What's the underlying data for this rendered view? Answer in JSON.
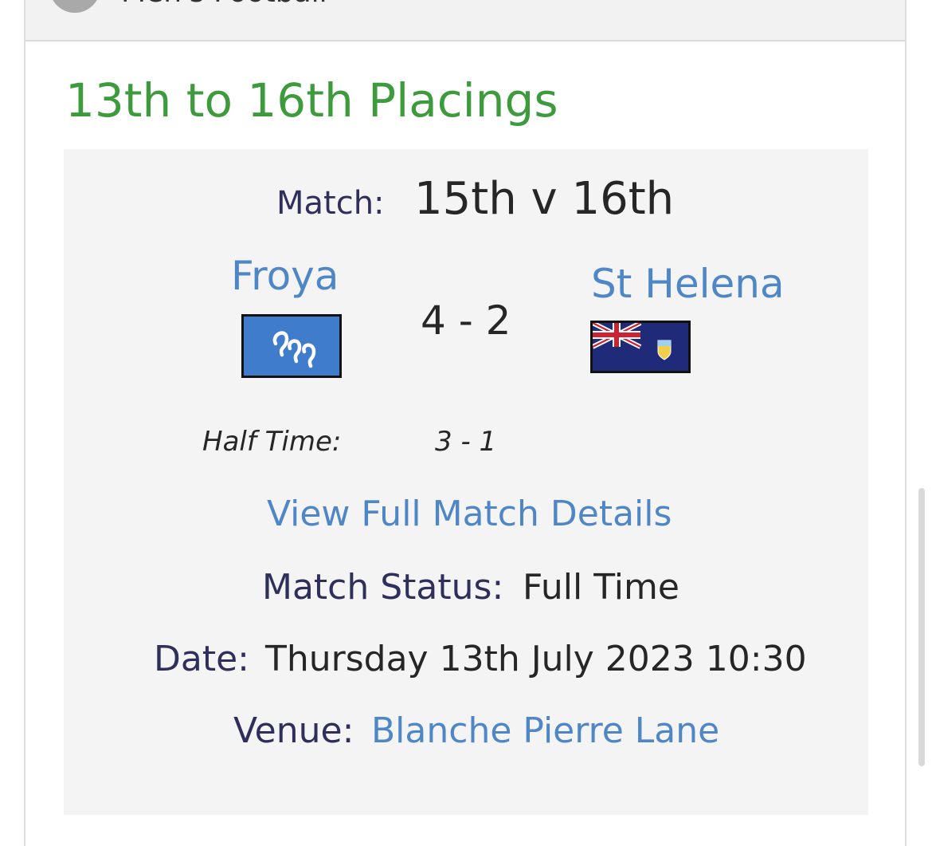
{
  "category": {
    "label": "Men's Football"
  },
  "section": {
    "title": "13th to 16th Placings"
  },
  "match": {
    "match_label": "Match:",
    "match_value": "15th v 16th",
    "home_team": "Froya",
    "away_team": "St Helena",
    "score": "4 - 2",
    "half_time_label": "Half Time:",
    "half_time_score": "3 - 1",
    "details_link": "View Full Match Details",
    "status_label": "Match Status:",
    "status_value": "Full Time",
    "date_label": "Date:",
    "date_value": "Thursday 13th July 2023 10:30",
    "venue_label": "Venue:",
    "venue_value": "Blanche Pierre Lane"
  },
  "colors": {
    "section_title": "#3d9a3d",
    "link": "#4f86c6",
    "label": "#2f2f5c",
    "card_bg": "#f4f4f4"
  },
  "icons": {
    "home_flag": "froya-flag-icon",
    "away_flag": "st-helena-flag-icon",
    "category_icon": "category-circle-icon"
  }
}
